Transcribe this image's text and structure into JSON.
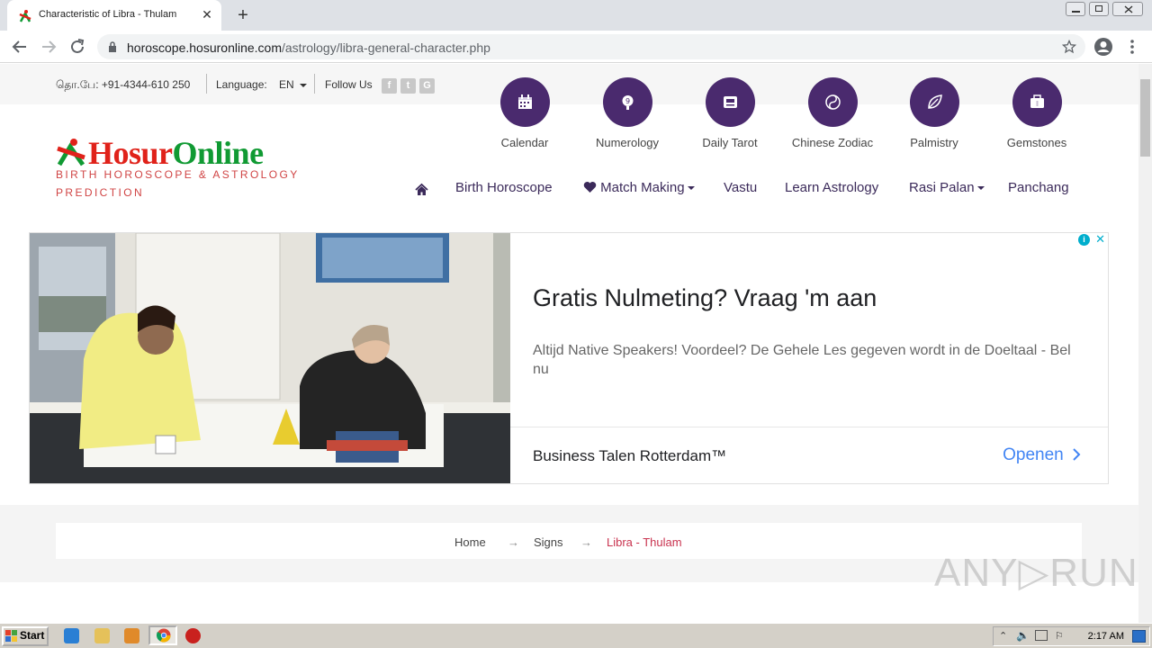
{
  "browser": {
    "tab_title": "Characteristic of Libra - Thulam",
    "tab_close": "✕",
    "new_tab": "+",
    "url_host": "horoscope.hosuronline.com",
    "url_path": "/astrology/libra-general-character.php"
  },
  "topbar": {
    "phone": "தொ.பே: +91-4344-610 250",
    "language_label": "Language:",
    "language_value": "EN",
    "follow": "Follow Us",
    "social_icons": [
      "facebook-icon",
      "twitter-icon",
      "google-plus-icon"
    ]
  },
  "logo": {
    "part1": "Hosur",
    "part2": "Online",
    "tagline": "BIRTH HOROSCOPE & ASTROLOGY PREDICTION"
  },
  "services": [
    {
      "label": "Calendar",
      "icon": "calendar-icon"
    },
    {
      "label": "Numerology",
      "icon": "numerology-icon"
    },
    {
      "label": "Daily Tarot",
      "icon": "tarot-icon"
    },
    {
      "label": "Chinese Zodiac",
      "icon": "yin-yang-icon"
    },
    {
      "label": "Palmistry",
      "icon": "leaf-icon"
    },
    {
      "label": "Gemstones",
      "icon": "gem-icon"
    }
  ],
  "nav": {
    "home_icon": "home-icon",
    "birth_horoscope": "Birth Horoscope",
    "match_making": "Match Making",
    "vastu": "Vastu",
    "learn_astrology": "Learn Astrology",
    "rasi_palan": "Rasi Palan",
    "panchang": "Panchang"
  },
  "ad": {
    "headline": "Gratis Nulmeting? Vraag 'm aan",
    "body": "Altijd Native Speakers! Voordeel? De Gehele Les gegeven wordt in de Doeltaal - Bel nu",
    "advertiser": "Business Talen Rotterdam™",
    "cta": "Openen",
    "info": "i",
    "close": "✕"
  },
  "breadcrumb": {
    "home": "Home",
    "signs": "Signs",
    "current": "Libra - Thulam",
    "separator": "→"
  },
  "watermark": "ANY▷RUN",
  "taskbar": {
    "start": "Start",
    "clock": "2:17 AM"
  },
  "colors": {
    "brand_purple": "#4a2a6e",
    "logo_red": "#e0221a",
    "logo_green": "#109a33",
    "ad_link": "#4285f4",
    "crumb_active": "#c9334f"
  }
}
